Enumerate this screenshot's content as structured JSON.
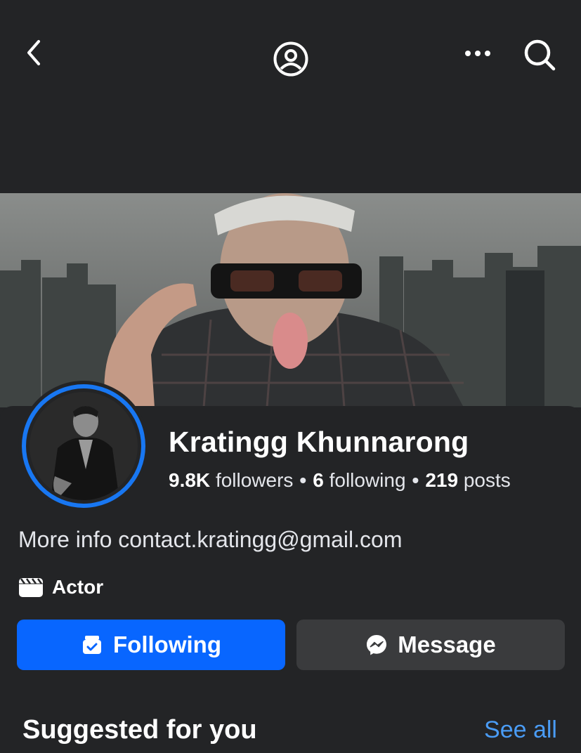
{
  "header": {
    "back_icon": "chevron-left-icon",
    "profile_icon": "profile-circle-icon",
    "more_icon": "ellipsis-icon",
    "search_icon": "search-icon"
  },
  "profile": {
    "name": "Kratingg Khunnarong",
    "followers_count": "9.8K",
    "followers_label": "followers",
    "following_count": "6",
    "following_label": "following",
    "posts_count": "219",
    "posts_label": "posts",
    "separator": "•",
    "bio": "More info contact.kratingg@gmail.com",
    "category": "Actor"
  },
  "actions": {
    "following_label": "Following",
    "message_label": "Message"
  },
  "suggested": {
    "title": "Suggested for you",
    "see_all": "See all"
  },
  "colors": {
    "background": "#232426",
    "primary_button": "#0866ff",
    "secondary_button": "#3a3b3d",
    "link": "#4a9cf5",
    "avatar_ring": "#1877f2"
  }
}
